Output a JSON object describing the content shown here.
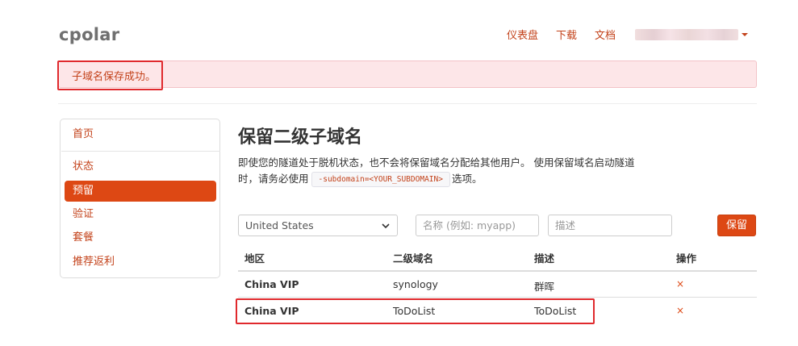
{
  "header": {
    "brand": "cpolar",
    "nav": {
      "dashboard": "仪表盘",
      "download": "下载",
      "docs": "文档"
    }
  },
  "alert": {
    "message": "子域名保存成功。"
  },
  "sidebar": {
    "items": [
      {
        "label": "首页"
      },
      {
        "label": "状态"
      },
      {
        "label": "预留"
      },
      {
        "label": "验证"
      },
      {
        "label": "套餐"
      },
      {
        "label": "推荐返利"
      }
    ],
    "active_index": 2
  },
  "main": {
    "title": "保留二级子域名",
    "description_line1": "即使您的隧道处于脱机状态，也不会将保留域名分配给其他用户。 使用保留域名启动隧道",
    "description_line2_prefix": "时，请务必使用",
    "description_code": "-subdomain=<YOUR_SUBDOMAIN>",
    "description_line2_suffix": "选项。",
    "form": {
      "region_value": "United States",
      "subdomain_placeholder": "名称 (例如: myapp)",
      "description_placeholder": "描述",
      "save_label": "保留"
    },
    "table": {
      "headers": [
        "地区",
        "二级域名",
        "描述",
        "操作"
      ],
      "rows": [
        {
          "region": "China VIP",
          "subdomain": "synology",
          "description": "群晖",
          "action": "×"
        },
        {
          "region": "China VIP",
          "subdomain": "ToDoList",
          "description": "ToDoList",
          "action": "×"
        }
      ]
    }
  },
  "colors": {
    "accent": "#dd4814",
    "link": "#c3421a",
    "alert_bg": "#fde6e8",
    "highlight_box": "#e0292d"
  }
}
